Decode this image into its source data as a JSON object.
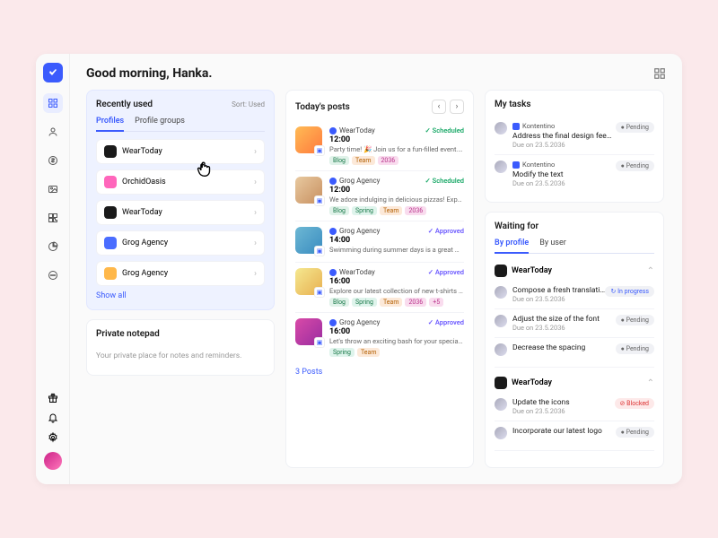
{
  "header": {
    "greeting": "Good morning, Hanka."
  },
  "recently_used": {
    "title": "Recently used",
    "sort_label": "Sort: Used",
    "tabs": [
      "Profiles",
      "Profile groups"
    ],
    "active_tab": 0,
    "items": [
      {
        "name": "WearToday",
        "color": "#1a1a1a"
      },
      {
        "name": "OrchidOasis",
        "color": "#f6b"
      },
      {
        "name": "WearToday",
        "color": "#1a1a1a"
      },
      {
        "name": "Grog Agency",
        "color": "#4a6dff"
      },
      {
        "name": "Grog Agency",
        "color": "#ffb84a"
      }
    ],
    "show_all": "Show all"
  },
  "notepad": {
    "title": "Private notepad",
    "placeholder": "Your private place for notes and reminders."
  },
  "today_posts": {
    "title": "Today's posts",
    "more": "3 Posts",
    "items": [
      {
        "profile": "WearToday",
        "dot": "#3b5bfd",
        "time": "12:00",
        "text": "Party time! 🎉 Join us for a fun-filled event. #partyti…",
        "status": "Scheduled",
        "st": "sch",
        "thumb": "linear-gradient(135deg,#ffbb55,#ff7a3d)",
        "tags": [
          "Blog",
          "Team",
          "2036"
        ]
      },
      {
        "profile": "Grog Agency",
        "dot": "#3b5bfd",
        "time": "12:00",
        "text": "We adore indulging in delicious pizzas! Experience t…",
        "status": "Scheduled",
        "st": "sch",
        "thumb": "linear-gradient(135deg,#e8c9a0,#c89060)",
        "tags": [
          "Blog",
          "Spring",
          "Team",
          "2036"
        ]
      },
      {
        "profile": "Grog Agency",
        "dot": "#3b5bfd",
        "time": "14:00",
        "text": "Swimming during summer days is a great way to refresh yourself and enjoy the sunny weather! Don'…",
        "status": "Approved",
        "st": "apr",
        "thumb": "linear-gradient(135deg,#6db8d4,#3a8cc0)",
        "tags": []
      },
      {
        "profile": "WearToday",
        "dot": "#3b5bfd",
        "time": "16:00",
        "text": "Explore our latest collection of new t-shirts at ama…",
        "status": "Approved",
        "st": "apr",
        "thumb": "linear-gradient(135deg,#f5e890,#e8b050)",
        "tags": [
          "Blog",
          "Spring",
          "Team",
          "2036",
          "+5"
        ]
      },
      {
        "profile": "Grog Agency",
        "dot": "#3b5bfd",
        "time": "16:00",
        "text": "Let's throw an exciting bash for your special day!…",
        "status": "Approved",
        "st": "apr",
        "thumb": "linear-gradient(135deg,#d94aa8,#9a2da0)",
        "tags": [
          "Spring",
          "Team"
        ]
      }
    ]
  },
  "my_tasks": {
    "title": "My tasks",
    "kont": "Kontentino",
    "items": [
      {
        "title": "Address the final design feedback",
        "due": "Due on 23.5.2036",
        "badge": "Pending",
        "btype": "pending"
      },
      {
        "title": "Modify the text",
        "due": "Due on 23.5.2036",
        "badge": "Pending",
        "btype": "pending"
      }
    ]
  },
  "waiting": {
    "title": "Waiting for",
    "tabs": [
      "By profile",
      "By user"
    ],
    "sections": [
      {
        "name": "WearToday",
        "color": "#1a1a1a",
        "items": [
          {
            "title": "Compose a fresh translation",
            "due": "Due on 23.5.2036",
            "badge": "In progress",
            "btype": "progress"
          },
          {
            "title": "Adjust the size of the font",
            "due": "Due on 23.5.2036",
            "badge": "Pending",
            "btype": "pending"
          },
          {
            "title": "Decrease the spacing",
            "due": "",
            "badge": "Pending",
            "btype": "pending"
          }
        ]
      },
      {
        "name": "WearToday",
        "color": "#1a1a1a",
        "items": [
          {
            "title": "Update the icons",
            "due": "Due on 23.5.2036",
            "badge": "Blocked",
            "btype": "blocked"
          },
          {
            "title": "Incorporate our latest logo",
            "due": "",
            "badge": "Pending",
            "btype": "pending"
          }
        ]
      }
    ]
  }
}
